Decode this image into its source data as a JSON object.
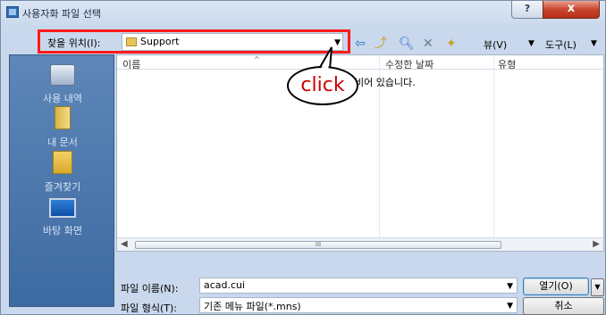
{
  "window": {
    "title": "사용자화 파일 선택",
    "help_label": "?",
    "close_label": "x"
  },
  "toolbar": {
    "lookin_label": "찾을 위치(I):",
    "lookin_value": "Support",
    "view_label": "뷰(V)",
    "tools_label": "도구(L)"
  },
  "sidebar": {
    "items": [
      {
        "label": "사용 내역",
        "icon": "history-icon"
      },
      {
        "label": "내 문서",
        "icon": "documents-icon"
      },
      {
        "label": "즐겨찾기",
        "icon": "favorites-icon"
      },
      {
        "label": "바탕 화면",
        "icon": "desktop-icon"
      }
    ]
  },
  "list": {
    "columns": [
      "이름",
      "수정한 날짜",
      "유형"
    ],
    "empty_message": "비어 있습니다.",
    "scroll_thumb_mark": "III"
  },
  "form": {
    "filename_label": "파일 이름(N):",
    "filename_value": "acad.cui",
    "filetype_label": "파일 형식(T):",
    "filetype_value": "기존 메뉴 파일(*.mns)",
    "open_label": "열기(O)",
    "cancel_label": "취소"
  },
  "annotation": {
    "callout_text": "click",
    "highlight_color": "#ff1a1a"
  }
}
